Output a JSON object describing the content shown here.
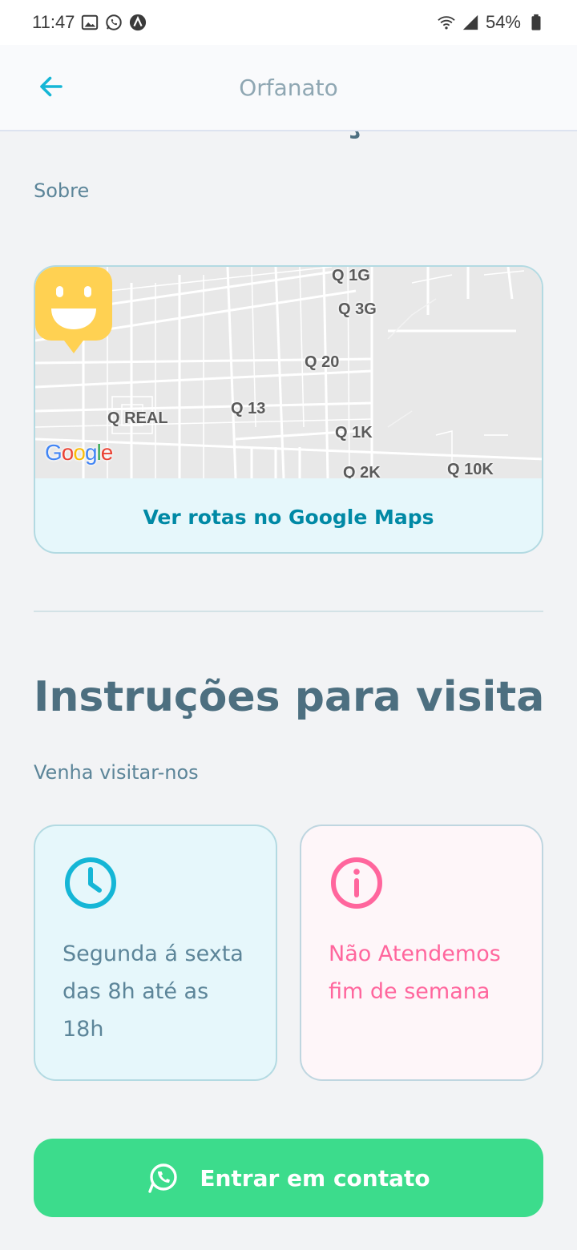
{
  "status_bar": {
    "time": "11:47",
    "battery": "54%"
  },
  "header": {
    "title": "Orfanato"
  },
  "orphanage": {
    "name": "Lar dos Abençoados",
    "about_label": "Sobre"
  },
  "map": {
    "street_labels": [
      "Q 1G",
      "Q 3G",
      "Q 20",
      "Q REAL",
      "Q 13",
      "Q 1K",
      "Q 2K",
      "Q 10K"
    ],
    "routes_link": "Ver rotas no Google Maps"
  },
  "visit": {
    "title": "Instruções para visita",
    "subtitle": "Venha visitar-nos",
    "hours_text": "Segunda á sexta das 8h até as 18h",
    "weekend_text": "Não Atendemos fim de semana"
  },
  "contact_button": {
    "label": "Entrar em contato"
  },
  "colors": {
    "primary_text": "#4d6f80",
    "link": "#0089a5",
    "accent_blue": "#15b6d6",
    "accent_pink": "#ff669d",
    "whatsapp_green": "#3cdc8c",
    "pin_yellow": "#ffd152"
  }
}
